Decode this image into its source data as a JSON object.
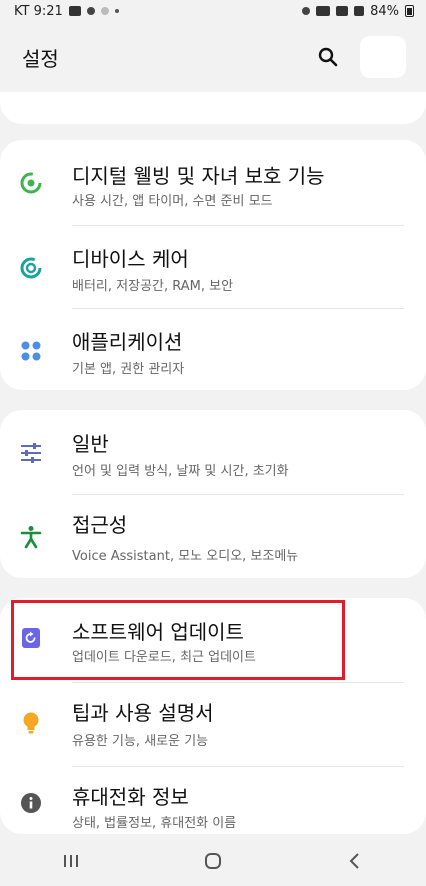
{
  "status_bar": {
    "carrier_time": "KT 9:21",
    "battery": "84%"
  },
  "header": {
    "title": "설정"
  },
  "partial_item": {
    "subtitle": ""
  },
  "groups": [
    {
      "items": [
        {
          "title": "디지털 웰빙 및 자녀 보호 기능",
          "subtitle": "사용 시간, 앱 타이머, 수면 준비 모드",
          "icon": "digital-wellbeing-icon",
          "color": "#3fb34f"
        },
        {
          "title": "디바이스 케어",
          "subtitle": "배터리, 저장공간, RAM, 보안",
          "icon": "device-care-icon",
          "color": "#1aa39a"
        },
        {
          "title": "애플리케이션",
          "subtitle": "기본 앱, 권한 관리자",
          "icon": "apps-icon",
          "color": "#4a8ee6"
        }
      ]
    },
    {
      "items": [
        {
          "title": "일반",
          "subtitle": "언어 및 입력 방식, 날짜 및 시간, 초기화",
          "icon": "general-sliders-icon",
          "color": "#5c6bc0"
        },
        {
          "title": "접근성",
          "subtitle": "Voice Assistant, 모노 오디오, 보조메뉴",
          "icon": "accessibility-icon",
          "color": "#1b8c3c"
        }
      ]
    },
    {
      "items": [
        {
          "title": "소프트웨어 업데이트",
          "subtitle": "업데이트 다운로드, 최근 업데이트",
          "icon": "software-update-icon",
          "color": "#6b66e8"
        },
        {
          "title": "팁과 사용 설명서",
          "subtitle": "유용한 기능, 새로운 기능",
          "icon": "tips-lightbulb-icon",
          "color": "#f5a623"
        },
        {
          "title": "휴대전화 정보",
          "subtitle": "상태, 법률정보, 휴대전화 이름",
          "icon": "phone-info-icon",
          "color": "#555555"
        }
      ]
    }
  ]
}
